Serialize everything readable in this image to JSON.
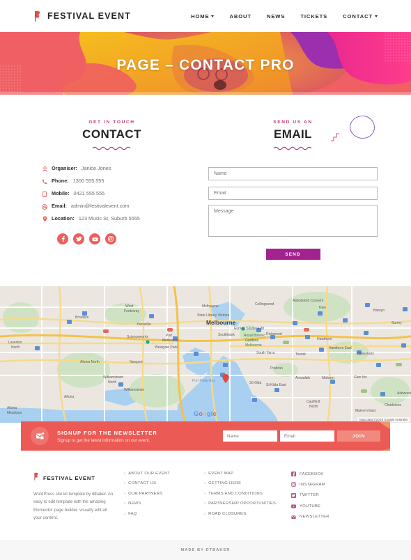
{
  "header": {
    "logo_text": "FESTIVAL EVENT",
    "logo_icon": "flag-icon",
    "nav": [
      {
        "label": "HOME",
        "has_caret": true
      },
      {
        "label": "ABOUT",
        "has_caret": false
      },
      {
        "label": "NEWS",
        "has_caret": false
      },
      {
        "label": "TICKETS",
        "has_caret": false
      },
      {
        "label": "CONTACT",
        "has_caret": true
      }
    ]
  },
  "hero": {
    "title": "PAGE – CONTACT PRO",
    "colors": {
      "coral": "#f0605f",
      "orange": "#f6a81c",
      "yellow": "#f5c518",
      "magenta": "#e8268f",
      "purple": "#9b2fae",
      "pink": "#ff3d8b"
    }
  },
  "contact": {
    "eyebrow": "GET IN TOUCH",
    "heading": "CONTACT",
    "details": [
      {
        "icon": "user-icon",
        "label": "Organiser:",
        "value": "Janice Jones"
      },
      {
        "icon": "phone-icon",
        "label": "Phone:",
        "value": "1300 555 555"
      },
      {
        "icon": "mobile-icon",
        "label": "Mobile:",
        "value": "0421 555 555"
      },
      {
        "icon": "email-icon",
        "label": "Email:",
        "value": "admin@festivalevent.com"
      },
      {
        "icon": "location-pin-icon",
        "label": "Location:",
        "value": "123 Music St, Suburb 5555"
      }
    ],
    "socials": [
      {
        "name": "facebook-icon",
        "glyph": "f"
      },
      {
        "name": "twitter-icon",
        "glyph": "t"
      },
      {
        "name": "youtube-icon",
        "glyph": "y"
      },
      {
        "name": "instagram-icon",
        "glyph": "i"
      }
    ],
    "social_color": "#ec605e",
    "accent_color": "#c0397c"
  },
  "email_form": {
    "eyebrow": "SEND US AN",
    "heading": "EMAIL",
    "fields": {
      "name_placeholder": "Name",
      "email_placeholder": "Email",
      "message_placeholder": "Message"
    },
    "send_label": "SEND",
    "send_color": "#a2228f"
  },
  "map": {
    "provider_logo": "Google",
    "attribution": "Map data ©2019 Google   Australia",
    "city_label": "Melbourne",
    "labels": [
      "West Footscray",
      "Brooklyn",
      "Yarraville",
      "Scienceworks",
      "Port Melbourne",
      "Westgate Park",
      "Laverton North",
      "Altona North",
      "Newport",
      "Williamstown North",
      "Williamstown",
      "Altona",
      "Altona Meadows",
      "Melbourne",
      "Collingwood",
      "Abbotsford Convent",
      "State Library Victoria",
      "Eureka Skydeck 88",
      "Richmond",
      "Kew",
      "Balwyn",
      "Hawthorn",
      "Hawthorn East",
      "Canterbury",
      "Surrey Hills",
      "Royal Botanic Gardens Melbourne",
      "Southbank",
      "South Yarra",
      "Toorak",
      "Prahran",
      "Armadale",
      "Malvern",
      "Glen Iris",
      "St Kilda",
      "St Kilda East",
      "Caulfield North",
      "Malvern East",
      "Chadstone",
      "Port Philip Bay",
      "Ashwood"
    ]
  },
  "newsletter": {
    "icon": "mail-subscribe-icon",
    "title": "SIGNUP FOR THE NEWSLETTER",
    "subtitle": "Signup to get the latest information on our event.",
    "name_placeholder": "Name",
    "email_placeholder": "Email",
    "join_label": "JOIN",
    "bg_color": "#ec5a56"
  },
  "footer": {
    "brand": {
      "logo_text": "FESTIVAL EVENT",
      "description": "WordPress site kit template by dtbaker. An easy to edit template with the amazing Elementor page builder. visually edit all your content."
    },
    "col1": [
      "ABOUT OUR EVENT",
      "CONTACT US",
      "OUR PARTNERS",
      "NEWS",
      "FAQ"
    ],
    "col2": [
      "EVENT MAP",
      "GETTING HERE",
      "TERMS AND CONDITIONS",
      "PARTNERSHIP OPPORTUNITIES",
      "ROAD CLOSURES"
    ],
    "socials": [
      {
        "icon": "facebook-icon",
        "label": "FACEBOOK"
      },
      {
        "icon": "instagram-icon",
        "label": "INSTAGRAM"
      },
      {
        "icon": "twitter-icon",
        "label": "TWITTER"
      },
      {
        "icon": "youtube-icon",
        "label": "YOUTUBE"
      },
      {
        "icon": "newsletter-icon",
        "label": "NEWSLETTER"
      }
    ]
  },
  "bottombar": {
    "text": "MADE BY DTBAKER"
  }
}
